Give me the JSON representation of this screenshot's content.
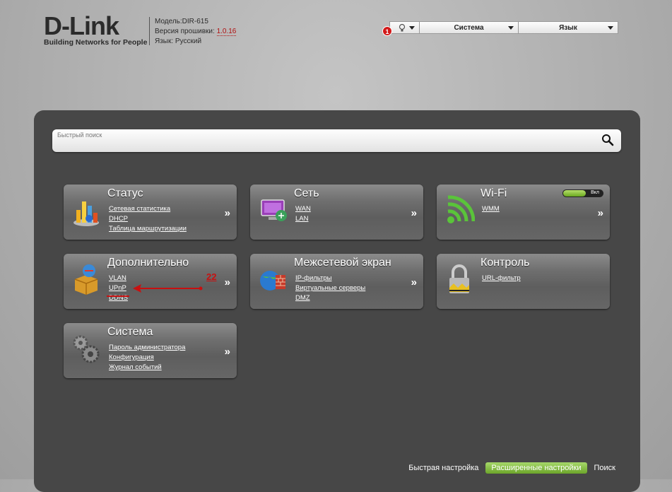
{
  "header": {
    "logo_text": "D-Link",
    "logo_tagline": "Building Networks for People",
    "model_label": "Модель:DIR-615",
    "firmware_label": "Версия прошивки:",
    "firmware_value": "1.0.16",
    "language_label": "Язык: Русский"
  },
  "topbar": {
    "badge": "1",
    "system_label": "Система",
    "language_label": "Язык"
  },
  "search": {
    "placeholder": "Быстрый поиск"
  },
  "cards": {
    "status": {
      "title": "Статус",
      "links": [
        "Сетевая статистика",
        "DHCP",
        "Таблица маршрутизации"
      ],
      "arrow": "»"
    },
    "network": {
      "title": "Сеть",
      "links": [
        "WAN",
        "LAN"
      ],
      "arrow": "»"
    },
    "wifi": {
      "title": "Wi-Fi",
      "links": [
        "WMM"
      ],
      "arrow": "»",
      "toggle_label": "Вкл"
    },
    "advanced": {
      "title": "Дополнительно",
      "links": [
        "VLAN",
        "UPnP",
        "DDNS"
      ],
      "arrow": "»"
    },
    "firewall": {
      "title": "Межсетевой экран",
      "links": [
        "IP-фильтры",
        "Виртуальные серверы",
        "DMZ"
      ],
      "arrow": "»"
    },
    "control": {
      "title": "Контроль",
      "links": [
        "URL-фильтр"
      ]
    },
    "system": {
      "title": "Система",
      "links": [
        "Пароль администратора",
        "Конфигурация",
        "Журнал событий"
      ],
      "arrow": "»"
    }
  },
  "annotation": {
    "number": "22"
  },
  "bottom_nav": {
    "quick_setup": "Быстрая настройка",
    "advanced_settings": "Расширенные настройки",
    "search": "Поиск"
  },
  "colors": {
    "accent_green": "#8cc646",
    "panel_bg": "#474747",
    "annotation_red": "#c81010"
  }
}
